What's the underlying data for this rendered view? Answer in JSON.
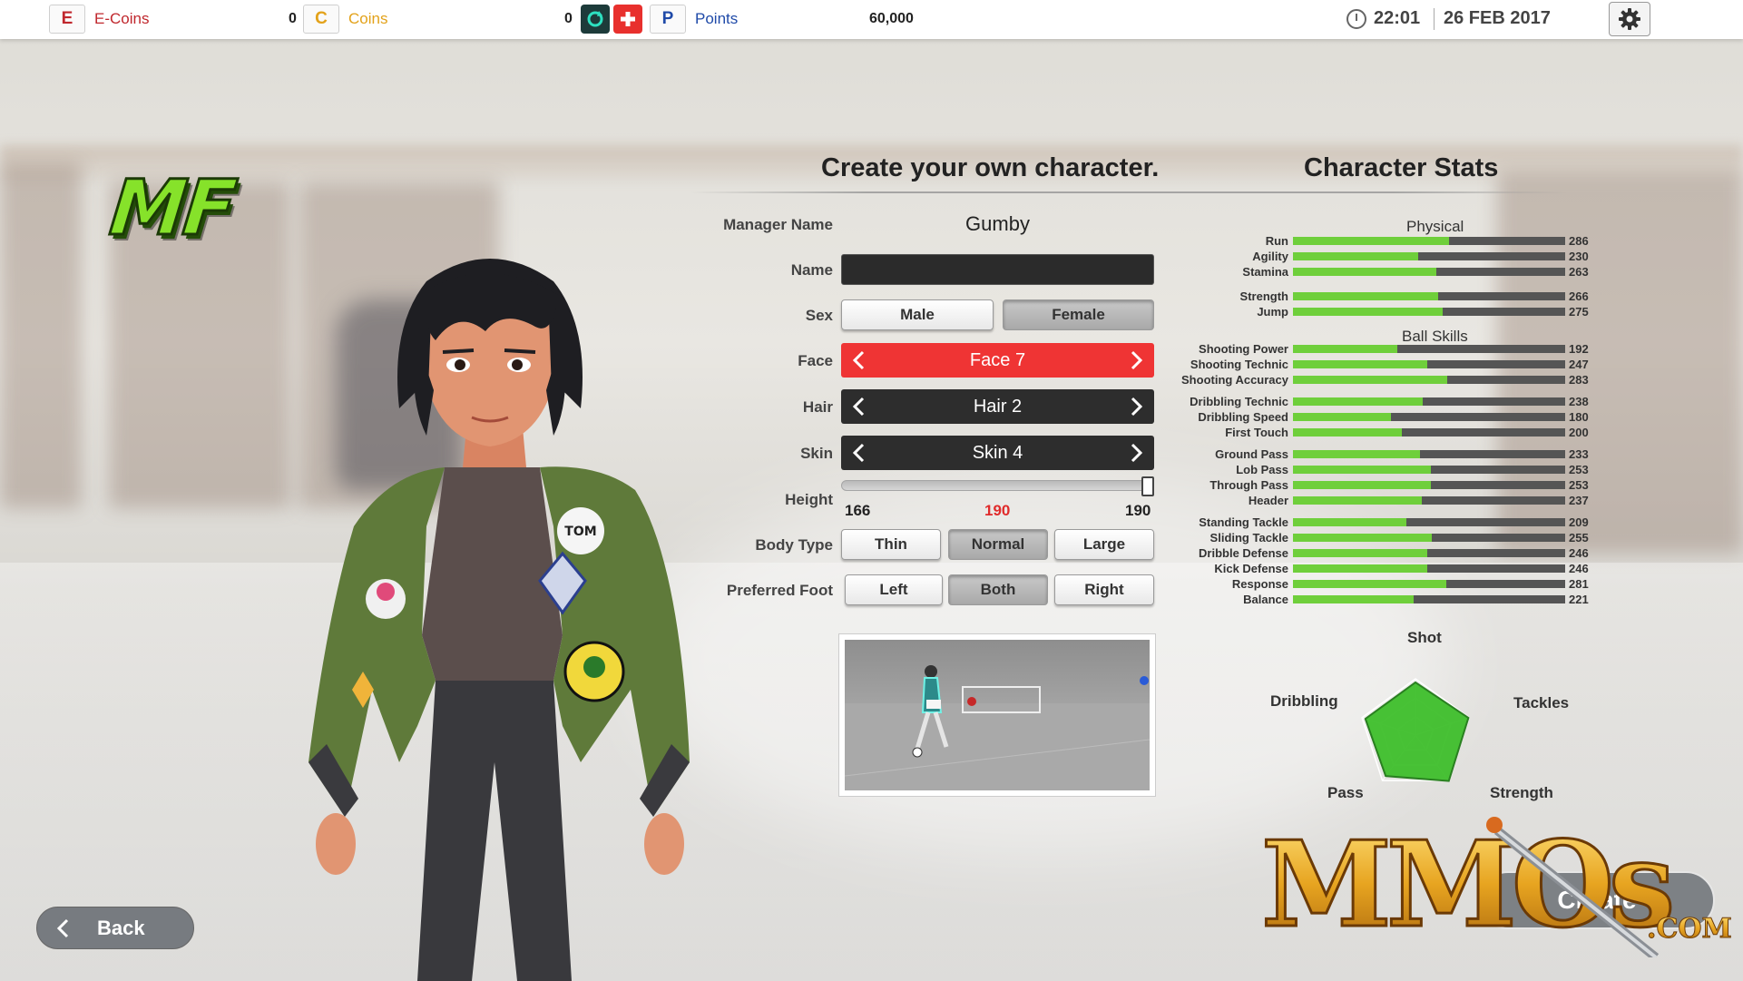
{
  "topbar": {
    "ecoins": {
      "letter": "E",
      "label": "E-Coins",
      "value": "0",
      "color": "#c0272d"
    },
    "coins": {
      "letter": "C",
      "label": "Coins",
      "value": "0",
      "color": "#e3a21a"
    },
    "points": {
      "letter": "P",
      "label": "Points",
      "value": "60,000",
      "color": "#1f4aa8"
    },
    "time": "22:01",
    "date": "26 FEB 2017"
  },
  "badge": {
    "position": "MF",
    "color": "#86e22a"
  },
  "create": {
    "title": "Create your own character.",
    "manager_name_label": "Manager Name",
    "manager_name": "Gumby",
    "name_label": "Name",
    "name_value": "",
    "sex": {
      "label": "Sex",
      "options": [
        "Male",
        "Female"
      ],
      "selected": "Female"
    },
    "face": {
      "label": "Face",
      "value": "Face 7"
    },
    "hair": {
      "label": "Hair",
      "value": "Hair 2"
    },
    "skin": {
      "label": "Skin",
      "value": "Skin 4"
    },
    "height": {
      "label": "Height",
      "min": "166",
      "current": "190",
      "max": "190",
      "fraction": 1.0
    },
    "body_type": {
      "label": "Body Type",
      "options": [
        "Thin",
        "Normal",
        "Large"
      ],
      "selected": "Normal"
    },
    "foot": {
      "label": "Preferred Foot",
      "options": [
        "Left",
        "Both",
        "Right"
      ],
      "selected": "Both"
    }
  },
  "stats": {
    "title": "Character Stats",
    "max": 500,
    "groups": [
      {
        "title": "Physical",
        "items": [
          {
            "label": "Run",
            "value": 286
          },
          {
            "label": "Agility",
            "value": 230
          },
          {
            "label": "Stamina",
            "value": 263
          },
          {
            "label": "Strength",
            "value": 266
          },
          {
            "label": "Jump",
            "value": 275
          }
        ]
      },
      {
        "title": "Ball Skills",
        "items": [
          {
            "label": "Shooting Power",
            "value": 192
          },
          {
            "label": "Shooting Technic",
            "value": 247
          },
          {
            "label": "Shooting Accuracy",
            "value": 283
          },
          {
            "label": "Dribbling Technic",
            "value": 238
          },
          {
            "label": "Dribbling Speed",
            "value": 180
          },
          {
            "label": "First Touch",
            "value": 200
          },
          {
            "label": "Ground Pass",
            "value": 233
          },
          {
            "label": "Lob Pass",
            "value": 253
          },
          {
            "label": "Through Pass",
            "value": 253
          },
          {
            "label": "Header",
            "value": 237
          },
          {
            "label": "Standing Tackle",
            "value": 209
          },
          {
            "label": "Sliding Tackle",
            "value": 255
          },
          {
            "label": "Dribble Defense",
            "value": 246
          },
          {
            "label": "Kick Defense",
            "value": 246
          },
          {
            "label": "Response",
            "value": 281
          },
          {
            "label": "Balance",
            "value": 221
          }
        ]
      }
    ]
  },
  "radar": {
    "axes": [
      "Shot",
      "Tackles",
      "Strength",
      "Pass",
      "Dribbling"
    ],
    "values": [
      0.52,
      0.55,
      0.56,
      0.5,
      0.52
    ],
    "color": "#3fbf2c"
  },
  "buttons": {
    "back": "Back",
    "create": "Create"
  },
  "watermark": {
    "text": "MMOs",
    "suffix": ".COM"
  }
}
